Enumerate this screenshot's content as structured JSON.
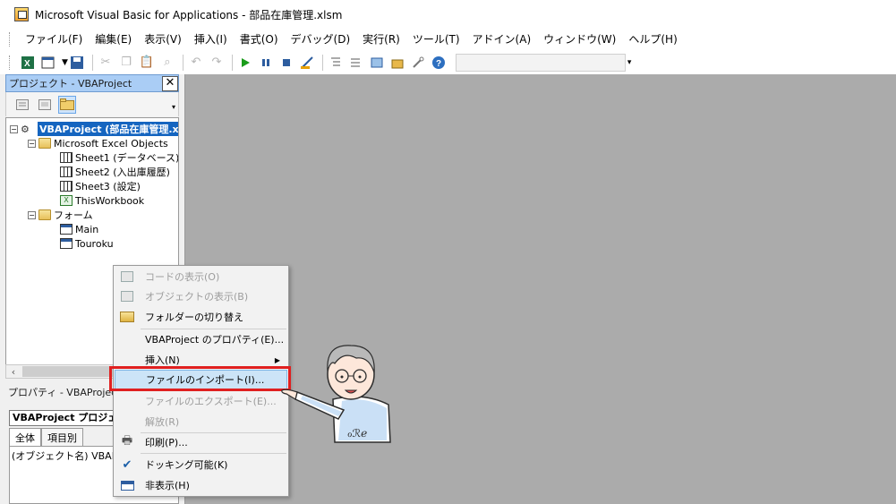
{
  "window": {
    "title": "Microsoft Visual Basic for Applications - 部品在庫管理.xlsm"
  },
  "menu": [
    "ファイル(F)",
    "編集(E)",
    "表示(V)",
    "挿入(I)",
    "書式(O)",
    "デバッグ(D)",
    "実行(R)",
    "ツール(T)",
    "アドイン(A)",
    "ウィンドウ(W)",
    "ヘルプ(H)"
  ],
  "toolbar": {
    "icons": [
      "excel-icon",
      "insert-userform-icon",
      "save-icon",
      "cut-icon",
      "copy-icon",
      "paste-icon",
      "find-icon",
      "undo-icon",
      "redo-icon",
      "run-icon",
      "break-icon",
      "reset-icon",
      "design-mode-icon",
      "project-explorer-icon",
      "properties-icon",
      "object-browser-icon",
      "toolbox-icon",
      "help-icon"
    ]
  },
  "project": {
    "title": "プロジェクト - VBAProject",
    "close": "✕",
    "tree": {
      "root": "VBAProject (部品在庫管理.xlsm)",
      "excel_objects": "Microsoft Excel Objects",
      "sheets": [
        "Sheet1 (データベース)",
        "Sheet2 (入出庫履歴)",
        "Sheet3 (設定)",
        "ThisWorkbook"
      ],
      "forms_folder": "フォーム",
      "forms": [
        "Main",
        "Touroku"
      ]
    }
  },
  "properties": {
    "title": "プロパティ - VBAProject",
    "object": "VBAProject プロジェクト",
    "tabs": [
      "全体",
      "項目別"
    ],
    "row_name": "(オブジェクト名)",
    "row_value": "VBAProject"
  },
  "context_menu": {
    "items": [
      {
        "label": "コードの表示(O)",
        "disabled": true,
        "icon": "view-code-icon"
      },
      {
        "label": "オブジェクトの表示(B)",
        "disabled": true,
        "icon": "view-object-icon"
      },
      {
        "label": "フォルダーの切り替え",
        "disabled": false,
        "icon": "folder-icon"
      },
      {
        "label": "VBAProject のプロパティ(E)...",
        "disabled": false,
        "icon": ""
      },
      {
        "label": "挿入(N)",
        "disabled": false,
        "icon": "",
        "submenu": true
      },
      {
        "label": "ファイルのインポート(I)...",
        "disabled": false,
        "icon": "",
        "highlighted": true
      },
      {
        "label": "ファイルのエクスポート(E)...",
        "disabled": true,
        "icon": ""
      },
      {
        "label": "解放(R)",
        "disabled": true,
        "icon": ""
      },
      {
        "label": "印刷(P)...",
        "disabled": false,
        "icon": "printer-icon"
      },
      {
        "label": "ドッキング可能(K)",
        "disabled": false,
        "icon": "check-icon"
      },
      {
        "label": "非表示(H)",
        "disabled": false,
        "icon": "hide-icon"
      }
    ]
  },
  "colors": {
    "selection": "#1565c0",
    "highlight_frame": "#e02020",
    "workspace": "#ababab"
  }
}
